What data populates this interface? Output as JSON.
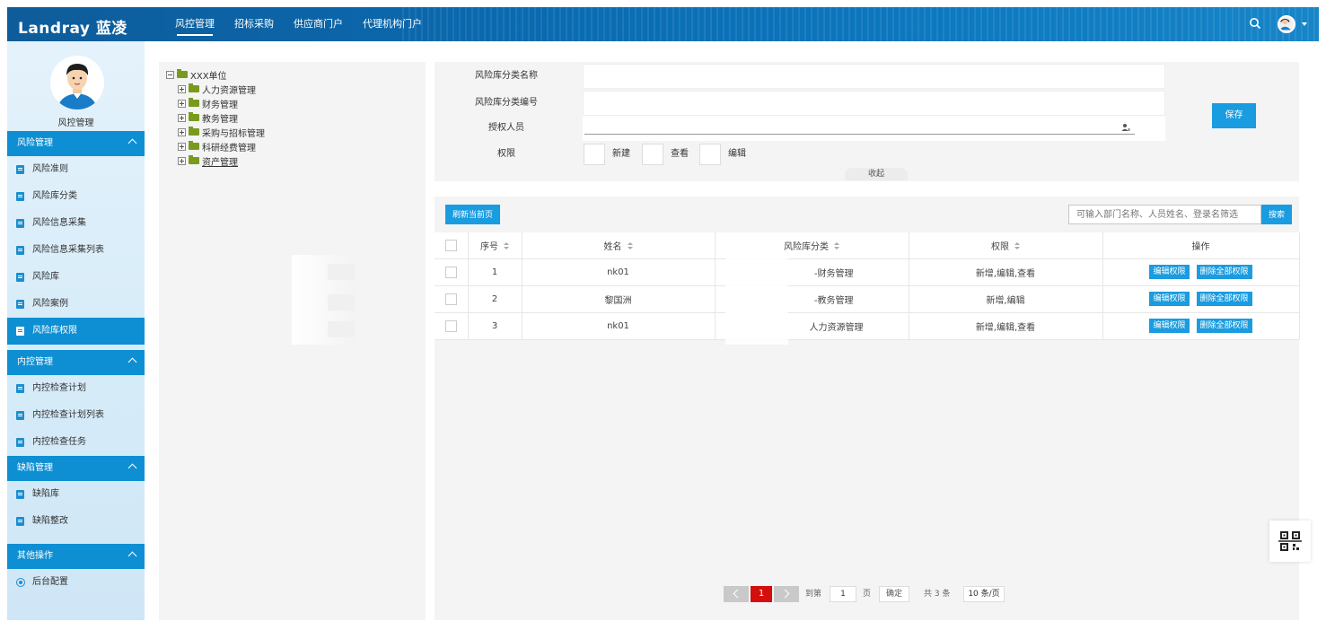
{
  "header": {
    "logo": "Landray 蓝凌",
    "nav": [
      "风控管理",
      "招标采购",
      "供应商门户",
      "代理机构门户"
    ],
    "active_nav": 0
  },
  "sidebar": {
    "username": "风控管理",
    "sections": [
      {
        "title": "风险管理",
        "items": [
          "风险准则",
          "风险库分类",
          "风险信息采集",
          "风险信息采集列表",
          "风险库",
          "风险案例",
          "风险库权限"
        ]
      },
      {
        "title": "内控管理",
        "items": [
          "内控检查计划",
          "内控检查计划列表",
          "内控检查任务"
        ]
      },
      {
        "title": "缺陷管理",
        "items": [
          "缺陷库",
          "缺陷整改"
        ]
      },
      {
        "title": "其他操作",
        "items": [
          "后台配置"
        ]
      }
    ],
    "active_item": "风险库权限"
  },
  "tree": {
    "root": "XXX单位",
    "children": [
      "人力资源管理",
      "财务管理",
      "教务管理",
      "采购与招标管理",
      "科研经费管理",
      "资产管理"
    ]
  },
  "form": {
    "label_name": "风险库分类名称",
    "label_code": "风险库分类编号",
    "label_auth": "授权人员",
    "label_perm": "权限",
    "perm_new": "新建",
    "perm_view": "查看",
    "perm_edit": "编辑",
    "save": "保存",
    "collapse": "收起"
  },
  "table": {
    "refresh": "刷新当前页",
    "search_placeholder": "可输入部门名称、人员姓名、登录名筛选",
    "search_btn": "搜索",
    "columns": [
      "序号",
      "姓名",
      "风险库分类",
      "权限",
      "操作"
    ],
    "rows": [
      {
        "no": "1",
        "name": "nk01",
        "category": "-财务管理",
        "perm": "新增,编辑,查看"
      },
      {
        "no": "2",
        "name": "黎国洲",
        "category": "-教务管理",
        "perm": "新增,编辑"
      },
      {
        "no": "3",
        "name": "nk01",
        "category": "人力资源管理",
        "perm": "新增,编辑,查看"
      }
    ],
    "op_edit": "编辑权限",
    "op_delete": "删除全部权限"
  },
  "pager": {
    "current": "1",
    "goto": "到第",
    "page_input": "1",
    "page_unit": "页",
    "confirm": "确定",
    "total": "共 3 条",
    "page_size": "10 条/页"
  },
  "colors": {
    "primary": "#1a9ce0",
    "header": "#0a5fa0",
    "pager_active": "#d40d0d"
  }
}
